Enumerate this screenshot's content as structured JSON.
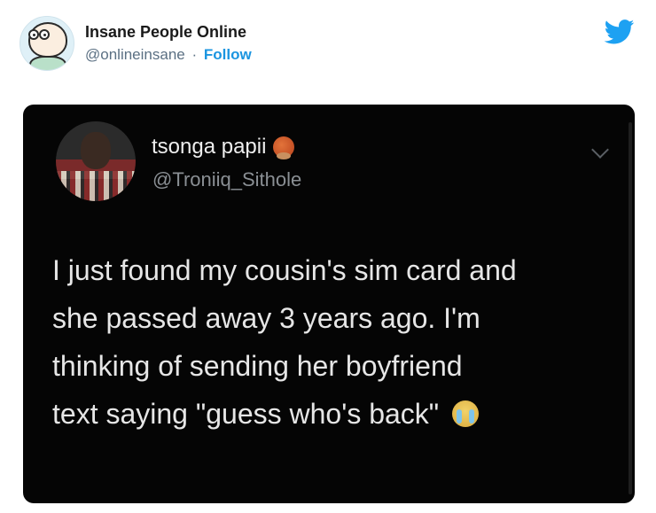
{
  "embed": {
    "author_name": "Insane People Online",
    "author_handle": "@onlineinsane",
    "separator": "·",
    "follow_label": "Follow",
    "brand_color": "#1da1f2",
    "icons": {
      "avatar": "cartoon-avatar",
      "logo": "twitter-bird-icon"
    }
  },
  "screenshot": {
    "name": "tsonga papii",
    "handle": "@Troniiq_Sithole",
    "name_emoji": "basketball-emoji",
    "text_lines": [
      "I just found my cousin's sim card and",
      "she passed away 3 years ago. I'm",
      "thinking of sending her boyfriend",
      "text saying \"guess who's back\""
    ],
    "trailing_emoji": "crying-face-emoji",
    "menu_icon": "chevron-down-icon"
  }
}
